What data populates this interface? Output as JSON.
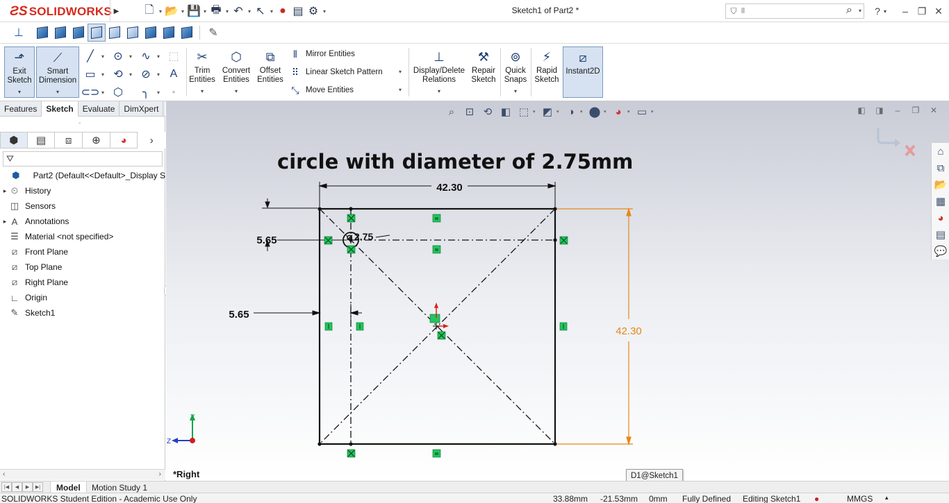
{
  "app": {
    "brand": "SOLIDWORKS",
    "doc_title": "Sketch1 of Part2 *",
    "search_placeholder": "ll"
  },
  "command_manager": {
    "exit_sketch": "Exit Sketch",
    "smart_dimension": "Smart Dimension",
    "trim_entities": "Trim Entities",
    "convert_entities": "Convert Entities",
    "offset_entities": "Offset Entities",
    "mirror_entities": "Mirror Entities",
    "linear_sketch_pattern": "Linear Sketch Pattern",
    "move_entities": "Move Entities",
    "display_delete_relations": "Display/Delete Relations",
    "repair_sketch": "Repair Sketch",
    "quick_snaps": "Quick Snaps",
    "rapid_sketch": "Rapid Sketch",
    "instant2d": "Instant2D"
  },
  "tabs": [
    "Features",
    "Sketch",
    "Evaluate",
    "DimXpert"
  ],
  "active_tab": "Sketch",
  "feature_tree": [
    {
      "label": "Part2  (Default<<Default>_Display S",
      "icon": "part-icon",
      "expandable": false
    },
    {
      "label": "History",
      "icon": "history-icon",
      "expandable": true
    },
    {
      "label": "Sensors",
      "icon": "sensors-icon",
      "expandable": false
    },
    {
      "label": "Annotations",
      "icon": "annotations-icon",
      "expandable": true
    },
    {
      "label": "Material <not specified>",
      "icon": "material-icon",
      "expandable": false
    },
    {
      "label": "Front Plane",
      "icon": "plane-icon",
      "expandable": false
    },
    {
      "label": "Top Plane",
      "icon": "plane-icon",
      "expandable": false
    },
    {
      "label": "Right Plane",
      "icon": "plane-icon",
      "expandable": false
    },
    {
      "label": "Origin",
      "icon": "origin-icon",
      "expandable": false
    },
    {
      "label": "Sketch1",
      "icon": "sketch-icon",
      "expandable": false
    }
  ],
  "graphics": {
    "annotation": "circle with diameter of 2.75mm",
    "dim_top": "42.30",
    "dim_right": "42.30",
    "dim_left_upper": "5.65",
    "dim_left_lower": "5.65",
    "dim_circle": "2.75",
    "view_name": "*Right",
    "tooltip": "D1@Sketch1",
    "axis_y": "Y",
    "axis_z": "Z",
    "dim_color": "#e8861a",
    "relation_color": "#22c55e"
  },
  "bottom_tabs": [
    "Model",
    "Motion Study 1"
  ],
  "status": {
    "edition": "SOLIDWORKS Student Edition - Academic Use Only",
    "x": "33.88mm",
    "y": "-21.53mm",
    "z": "0mm",
    "state": "Fully Defined",
    "editing": "Editing Sketch1",
    "units": "MMGS"
  }
}
